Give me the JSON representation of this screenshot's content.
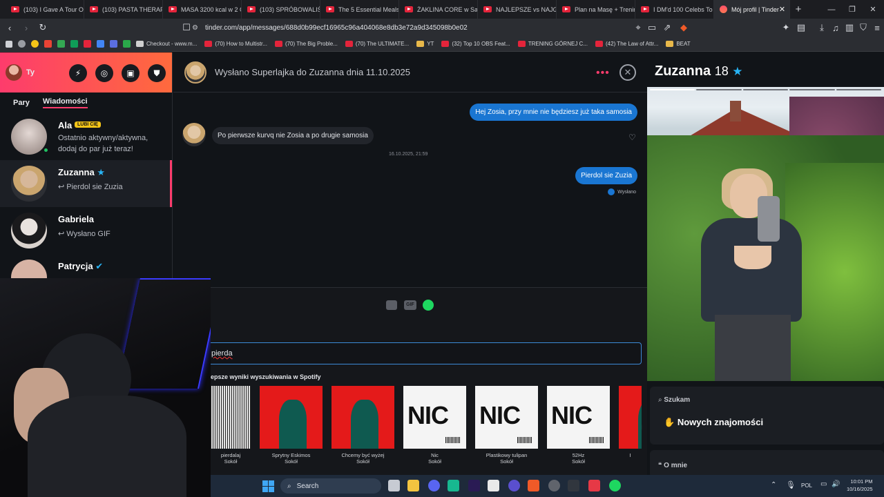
{
  "browser": {
    "tabs": [
      {
        "title": "(103) I Gave A Tour Of H",
        "fav": "yt"
      },
      {
        "title": "(103) PASTA THERAPY",
        "fav": "yt"
      },
      {
        "title": "MASA 3200 kcal w 2 G",
        "fav": "yt"
      },
      {
        "title": "(103) SPRÓBOWALIŚM",
        "fav": "yt"
      },
      {
        "title": "The 5 Essential Meals E",
        "fav": "yt"
      },
      {
        "title": "ŻAKLINA CORE w Sab",
        "fav": "yt"
      },
      {
        "title": "NAJLEPSZE vs NAJGOR",
        "fav": "yt"
      },
      {
        "title": "Plan na Masę + Trenin",
        "fav": "yt"
      },
      {
        "title": "I DM'd 100 Celebs To S",
        "fav": "yt"
      },
      {
        "title": "Mój profil | Tinder",
        "fav": "tinder"
      }
    ],
    "url": "tinder.com/app/messages/688d0b99ecf16965c96a404068e8db3e72a9d345098b0e02",
    "bookmarks": [
      {
        "label": "Checkout - www.m...",
        "color": "#cfcfcf"
      },
      {
        "label": "(70) How to Multistr...",
        "color": "#e4243b"
      },
      {
        "label": "(70) The Big Proble...",
        "color": "#e4243b"
      },
      {
        "label": "(70) The ULTIMATE...",
        "color": "#e4243b"
      },
      {
        "label": "YT",
        "color": "#e8b84a"
      },
      {
        "label": "(32) Top 10 OBS Feat...",
        "color": "#e4243b"
      },
      {
        "label": "TRENING GÓRNEJ C...",
        "color": "#e4243b"
      },
      {
        "label": "(42) The Law of Attr...",
        "color": "#e4243b"
      },
      {
        "label": "BEAT",
        "color": "#e8b84a"
      }
    ]
  },
  "sidebar": {
    "me_label": "Ty",
    "tabs": [
      "Pary",
      "Wiadomości"
    ],
    "matches": [
      {
        "name": "Ala",
        "badge": "LUBI CIĘ",
        "preview": "Ostatnio aktywny/aktywna, dodaj do par już teraz!"
      },
      {
        "name": "Zuzanna",
        "preview": "Pierdol sie Zuzia"
      },
      {
        "name": "Gabriela",
        "preview": "Wysłano GIF"
      },
      {
        "name": "Patrycja",
        "preview": ""
      }
    ]
  },
  "chat": {
    "header": "Wysłano Superlajka do Zuzanna dnia 11.10.2025",
    "messages": [
      {
        "side": "out",
        "text": "Hej Zosia, przy mnie nie będziesz już taka samosia"
      },
      {
        "side": "in",
        "text": "Po pierwsze kurvq nie Zosia a po drugie samosia"
      },
      {
        "side": "meta",
        "text": "16.10.2025, 21:59"
      },
      {
        "side": "out",
        "text": "Pierdol sie Zuzia"
      }
    ],
    "sent_label": "Wysłano",
    "input_value": "pierda",
    "spotify_heading": "epsze wyniki wyszukiwania w Spotify",
    "gif_label": "GIF",
    "songs": [
      {
        "title": "pierdalaj",
        "artist": "Sokół",
        "cover": "grey"
      },
      {
        "title": "Sprytny Eskimos",
        "artist": "Sokół",
        "cover": "red"
      },
      {
        "title": "Chcemy być wyżej",
        "artist": "Sokół",
        "cover": "red"
      },
      {
        "title": "Nic",
        "artist": "Sokół",
        "cover": "nic"
      },
      {
        "title": "Plastikowy tulipan",
        "artist": "Sokół",
        "cover": "nic"
      },
      {
        "title": "52Hz",
        "artist": "Sokół",
        "cover": "nic"
      },
      {
        "title": "I",
        "artist": "",
        "cover": "red"
      }
    ],
    "cover_text": "NIC"
  },
  "profile": {
    "name": "Zuzanna",
    "age": "18",
    "looking_label": "Szukam",
    "looking_value": "Nowych znajomości",
    "about_label": "O mnie"
  },
  "taskbar": {
    "search_label": "Search",
    "lang": "POL",
    "time": "10:01 PM",
    "date": "10/16/2025"
  },
  "colors": {
    "tinder_gradient_start": "#fd3c6c",
    "tinder_gradient_end": "#ff6a3d",
    "outgoing_bubble": "#1a76d2",
    "spotify": "#1ed760",
    "badge": "#f5c518"
  }
}
